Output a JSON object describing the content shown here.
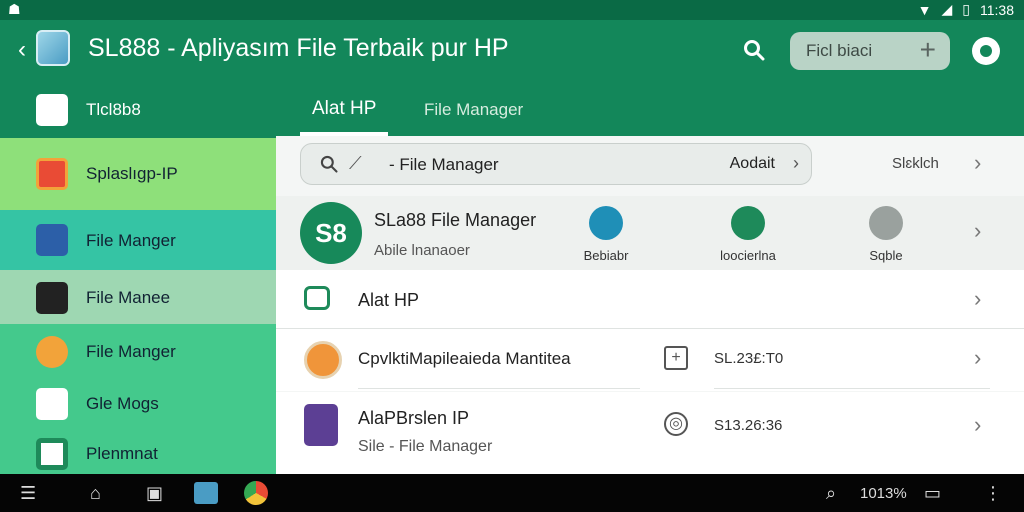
{
  "statusbar": {
    "left_icon": "android-icon",
    "time": "11:38",
    "icons": [
      "wifi-icon",
      "signal-icon",
      "battery-icon"
    ]
  },
  "appbar": {
    "title": "SL888 - Apliyasım File  Terbaik  pur HP",
    "pill_label": "Ficl biaci",
    "pill_plus": "+"
  },
  "sidebar": {
    "items": [
      {
        "label": "Tlcl8b8",
        "color": "#ffffff",
        "icon": "play-store-icon"
      },
      {
        "label": "Splaslıgp-IP",
        "color": "#e94b35",
        "icon": "ring-icon"
      },
      {
        "label": "File Manger",
        "color": "#2c5fa8",
        "icon": "folder-icon"
      },
      {
        "label": "File Manee",
        "color": "#222222",
        "icon": "arrow-icon"
      },
      {
        "label": "File Manger",
        "color": "#f2a33a",
        "icon": "gear-icon"
      },
      {
        "label": "Gle Mogs",
        "color": "#ffffff",
        "icon": "cloud-icon"
      },
      {
        "label": "Plenmnat",
        "color": "#ffffff",
        "icon": "grid-icon"
      }
    ]
  },
  "tabs": [
    {
      "label": "Alat HP"
    },
    {
      "label": "File Manager"
    }
  ],
  "searchbar": {
    "query": "- File Manager",
    "action": "Aodait",
    "chevron": "›"
  },
  "sort_label": "Slɛklch",
  "card": {
    "badge": "S8",
    "name": "SLa88  File Manager",
    "sub": "Abile lnanaoer",
    "actions": [
      {
        "label": "Bebiabr",
        "color": "#1f8fb7"
      },
      {
        "label": "loocierlna",
        "color": "#1e8a5a"
      },
      {
        "label": "Sqble",
        "color": "#9aa19e"
      }
    ]
  },
  "rows": [
    {
      "title": "Alat HP",
      "sub": "",
      "value": "",
      "icon": "camera-icon"
    },
    {
      "title": "CpvlktiMapileaieda Mantitea",
      "sub": "",
      "value": "SL.23£:T0",
      "icon": "orange-app-icon",
      "mid_icon": "+"
    },
    {
      "title": "AlaPBrslen IP",
      "sub": "Sile - File Manager",
      "value": "S13.26:36",
      "icon": "purple-app-icon",
      "mid_icon": "◎"
    }
  ],
  "navbar": {
    "zoom": "1013%"
  }
}
